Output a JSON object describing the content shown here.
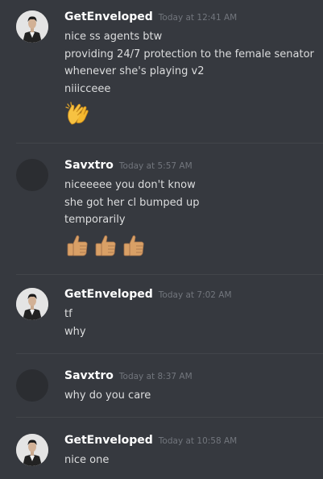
{
  "messages": [
    {
      "username": "GetEnveloped",
      "timestamp": "Today at 12:41 AM",
      "lines": [
        "nice ss agents btw",
        "providing 24/7 protection to the female senator",
        "whenever she's playing v2",
        "niiicceee"
      ],
      "emoji": [
        "clapping-hands-icon"
      ]
    },
    {
      "username": "Savxtro",
      "timestamp": "Today at 5:57 AM",
      "lines": [
        "niceeeee you don't know",
        "she got her cl bumped up",
        "temporarily"
      ],
      "emoji": [
        "thumbs-up-icon",
        "thumbs-up-icon",
        "thumbs-up-icon"
      ]
    },
    {
      "username": "GetEnveloped",
      "timestamp": "Today at 7:02 AM",
      "lines": [
        "tf",
        "why"
      ]
    },
    {
      "username": "Savxtro",
      "timestamp": "Today at 8:37 AM",
      "lines": [
        "why do you care"
      ]
    },
    {
      "username": "GetEnveloped",
      "timestamp": "Today at 10:58 AM",
      "lines": [
        "nice one"
      ]
    }
  ],
  "colors": {
    "background": "#36393f",
    "username": "#ffffff",
    "text": "#dcddde",
    "timestamp": "#72767d",
    "divider": "#42454a",
    "emoji_yellow": "#f7c242",
    "emoji_skin": "#d9a066"
  }
}
